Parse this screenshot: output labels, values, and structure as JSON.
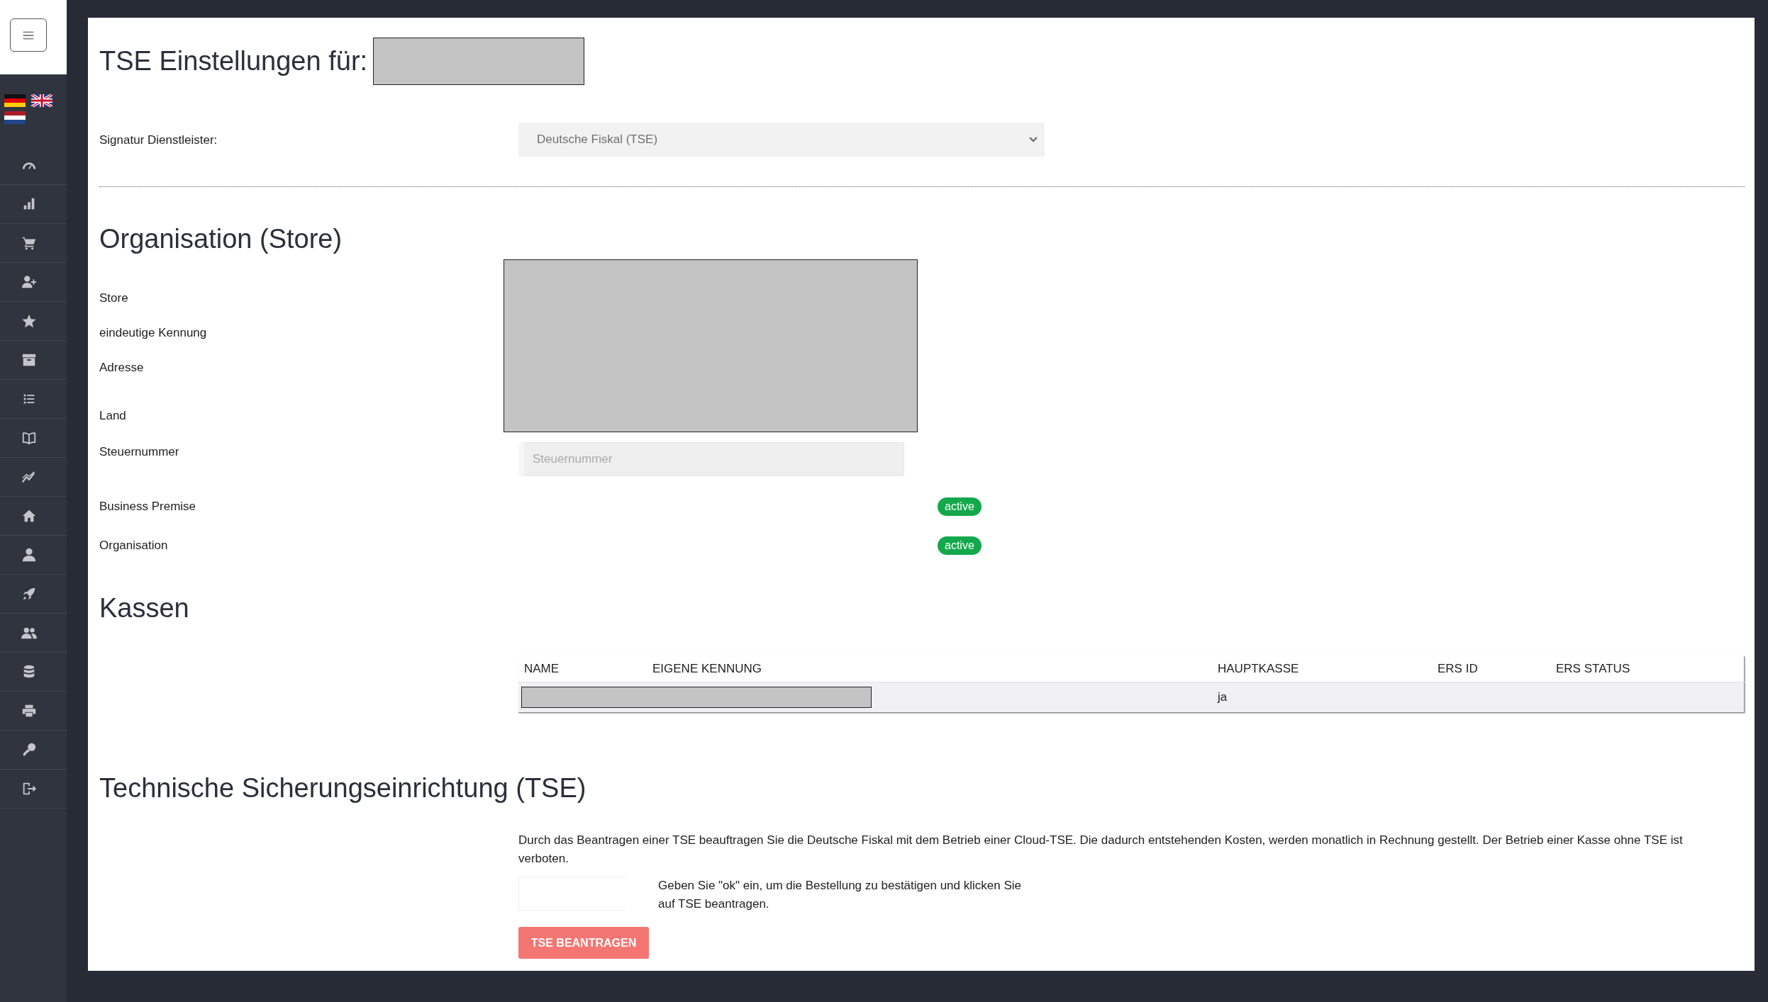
{
  "page": {
    "title": "TSE Einstellungen für:"
  },
  "signature_provider": {
    "label": "Signatur Dienstleister:",
    "value": "Deutsche Fiskal (TSE)"
  },
  "organisation": {
    "heading": "Organisation (Store)",
    "labels": [
      "Store",
      "eindeutige Kennung",
      "Adresse",
      "Land"
    ],
    "tax_number": {
      "label": "Steuernummer",
      "placeholder": "Steuernummer"
    },
    "statuses": [
      {
        "label": "Business Premise",
        "badge": "active"
      },
      {
        "label": "Organisation",
        "badge": "active"
      }
    ]
  },
  "registers": {
    "heading": "Kassen",
    "columns": [
      "NAME",
      "EIGENE KENNUNG",
      "HAUPTKASSE",
      "ERS ID",
      "ERS STATUS"
    ],
    "rows": [
      {
        "main_register": "ja"
      }
    ]
  },
  "tse": {
    "heading": "Technische Sicherungseinrichtung (TSE)",
    "notice": "Durch das Beantragen einer TSE beauftragen Sie die Deutsche Fiskal mit dem Betrieb einer Cloud-TSE. Die dadurch entstehenden Kosten, werden monatlich in Rechnung gestellt. Der Betrieb einer Kasse ohne TSE ist verboten.",
    "instruction": "Geben Sie \"ok\" ein, um die Bestellung zu bestätigen und klicken Sie auf TSE beantragen.",
    "button": "TSE BEANTRAGEN"
  }
}
